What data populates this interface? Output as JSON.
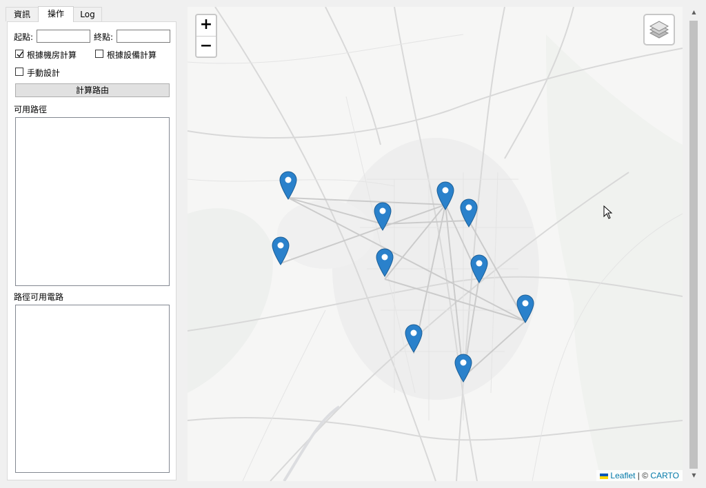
{
  "tabs": [
    {
      "label": "資訊",
      "active": false
    },
    {
      "label": "操作",
      "active": true
    },
    {
      "label": "Log",
      "active": false
    }
  ],
  "form": {
    "start_label": "起點:",
    "start_value": "",
    "end_label": "終點:",
    "end_value": "",
    "checkboxes": [
      {
        "label": "根據機房計算",
        "checked": true
      },
      {
        "label": "根據設備計算",
        "checked": false
      },
      {
        "label": "手動設計",
        "checked": false
      }
    ],
    "compute_button": "計算路由",
    "paths_label": "可用路徑",
    "cables_label": "路徑可用電路"
  },
  "map": {
    "zoom_in": "+",
    "zoom_out": "−",
    "attribution": {
      "leaflet": "Leaflet",
      "separator": " | © ",
      "carto": "CARTO"
    },
    "marker_color": "#2a81cb",
    "markers": [
      "marker-1",
      "marker-2",
      "marker-3",
      "marker-4",
      "marker-5",
      "marker-6",
      "marker-7",
      "marker-8",
      "marker-9",
      "marker-10"
    ]
  }
}
